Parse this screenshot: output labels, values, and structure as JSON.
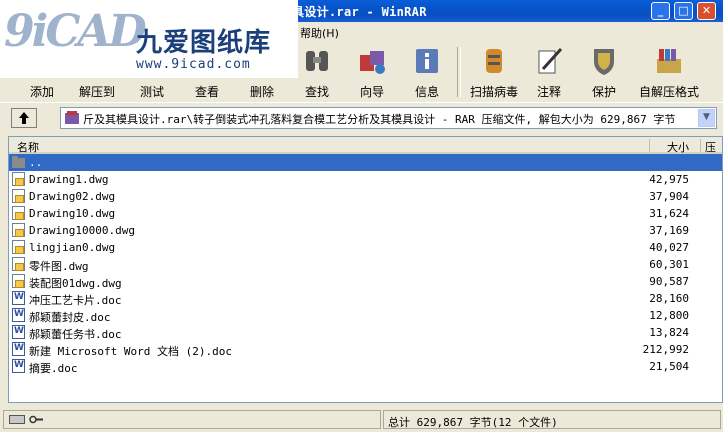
{
  "window": {
    "title": "具设计.rar - WinRAR",
    "controls": {
      "minimize": "_",
      "maximize": "□",
      "close": "✕"
    }
  },
  "watermark": {
    "brand_latin": "9iCAD",
    "brand_cn": "九爱图纸库",
    "url": "www.9icad.com"
  },
  "menubar": {
    "items": [
      "帮助(H)"
    ]
  },
  "toolbar": {
    "buttons": [
      {
        "label": "添加",
        "icon": "add-icon"
      },
      {
        "label": "解压到",
        "icon": "extract-to-icon"
      },
      {
        "label": "测试",
        "icon": "test-icon"
      },
      {
        "label": "查看",
        "icon": "view-icon"
      },
      {
        "label": "删除",
        "icon": "delete-icon"
      },
      {
        "label": "查找",
        "icon": "find-binoculars-icon"
      },
      {
        "label": "向导",
        "icon": "wizard-icon"
      },
      {
        "label": "信息",
        "icon": "info-icon"
      },
      {
        "label": "扫描病毒",
        "icon": "virus-scan-icon"
      },
      {
        "label": "注释",
        "icon": "comment-icon"
      },
      {
        "label": "保护",
        "icon": "protect-shield-icon"
      },
      {
        "label": "自解压格式",
        "icon": "sfx-icon"
      }
    ]
  },
  "address": {
    "path": "斤及其模具设计.rar\\转子倒装式冲孔落料复合模工艺分析及其模具设计 - RAR 压缩文件, 解包大小为 629,867 字节"
  },
  "columns": {
    "name": "名称",
    "size": "大小",
    "packed": "压"
  },
  "files": [
    {
      "name": "..",
      "size": "",
      "type": "folder"
    },
    {
      "name": "Drawing1.dwg",
      "size": "42,975",
      "type": "dwg"
    },
    {
      "name": "Drawing02.dwg",
      "size": "37,904",
      "type": "dwg"
    },
    {
      "name": "Drawing10.dwg",
      "size": "31,624",
      "type": "dwg"
    },
    {
      "name": "Drawing10000.dwg",
      "size": "37,169",
      "type": "dwg"
    },
    {
      "name": "lingjian0.dwg",
      "size": "40,027",
      "type": "dwg"
    },
    {
      "name": "零件图.dwg",
      "size": "60,301",
      "type": "dwg"
    },
    {
      "name": "装配图01dwg.dwg",
      "size": "90,587",
      "type": "dwg"
    },
    {
      "name": "冲压工艺卡片.doc",
      "size": "28,160",
      "type": "doc"
    },
    {
      "name": "郝颖蕾封皮.doc",
      "size": "12,800",
      "type": "doc"
    },
    {
      "name": "郝颖蕾任务书.doc",
      "size": "13,824",
      "type": "doc"
    },
    {
      "name": "新建 Microsoft Word 文档 (2).doc",
      "size": "212,992",
      "type": "doc"
    },
    {
      "name": "摘要.doc",
      "size": "21,504",
      "type": "doc"
    }
  ],
  "status": {
    "total": "总计 629,867 字节(12 个文件)"
  },
  "colors": {
    "selection": "#316ac5",
    "titlebar": "#0a5ed8"
  }
}
